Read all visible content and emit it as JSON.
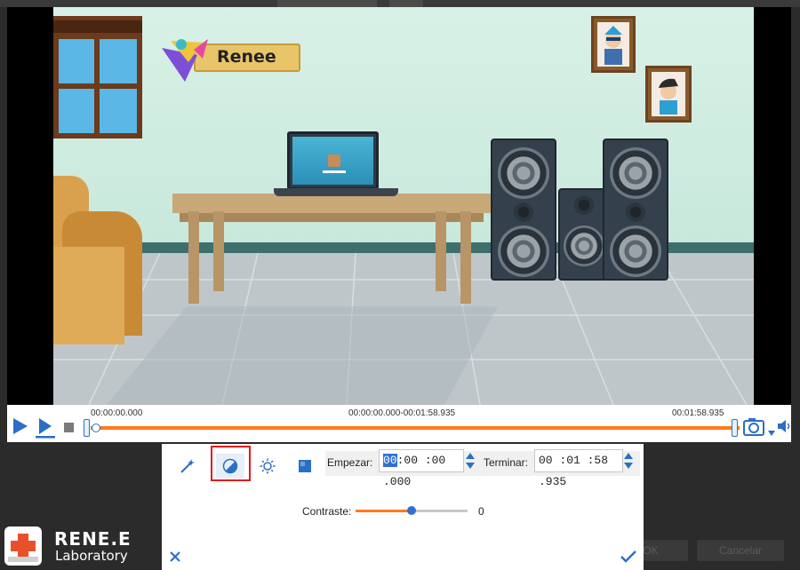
{
  "colors": {
    "accent": "#ff7a1a",
    "highlight": "#2f6fd6",
    "annotation_box": "#e01b1b"
  },
  "video": {
    "watermark_text": "Renee"
  },
  "player": {
    "time_start": "00:00:00.000",
    "time_range": "00:00:00.000-00:01:58.935",
    "time_end": "00:01:58.935",
    "progress_fraction": 0.0,
    "controls": {
      "play": "play-icon",
      "play_step": "play-step-icon",
      "stop": "stop-icon",
      "snapshot": "camera-icon",
      "snapshot_menu": "dropdown-arrow-icon",
      "volume": "volume-icon"
    }
  },
  "effect_panel": {
    "tools": [
      {
        "name": "magic-wand-icon",
        "active": false
      },
      {
        "name": "contrast-icon",
        "active": true
      },
      {
        "name": "brightness-icon",
        "active": false
      },
      {
        "name": "saturation-icon",
        "active": false
      }
    ],
    "start_label": "Empezar:",
    "start_value_selected": "00",
    "start_value_rest": ":00 :00 .000",
    "end_label": "Terminar:",
    "end_value": "00 :01 :58 .935",
    "contrast_label": "Contraste:",
    "contrast_value": "0",
    "contrast_fraction": 0.5,
    "cancel_icon": "close-icon",
    "confirm_icon": "checkmark-icon"
  },
  "brand": {
    "name": "RENE.E",
    "subtitle": "Laboratory"
  },
  "dialog_buttons": {
    "ok_label": "OK",
    "cancel_label": "Cancelar"
  }
}
